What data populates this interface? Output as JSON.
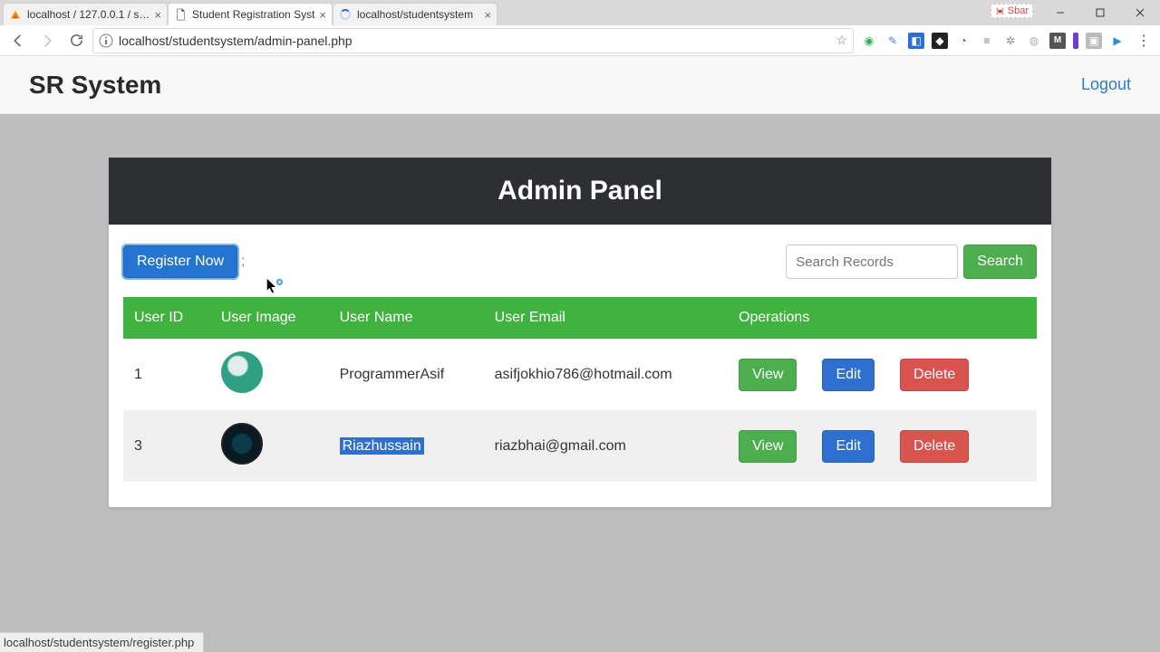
{
  "chrome": {
    "tabs": [
      {
        "title": "localhost / 127.0.0.1 / sr…"
      },
      {
        "title": "Student Registration Syst"
      },
      {
        "title": "localhost/studentsystem"
      }
    ],
    "share_label": "Sbar",
    "url": "localhost/studentsystem/admin-panel.php"
  },
  "header": {
    "brand": "SR System",
    "logout": "Logout"
  },
  "panel": {
    "title": "Admin Panel",
    "register_btn": "Register Now",
    "search_placeholder": "Search Records",
    "search_btn": "Search"
  },
  "table": {
    "headers": {
      "id": "User ID",
      "image": "User Image",
      "name": "User Name",
      "email": "User Email",
      "ops": "Operations"
    },
    "ops": {
      "view": "View",
      "edit": "Edit",
      "delete": "Delete"
    },
    "rows": [
      {
        "id": "1",
        "name": "ProgrammerAsif",
        "email": "asifjokhio786@hotmail.com"
      },
      {
        "id": "3",
        "name": "Riazhussain",
        "email": "riazbhai@gmail.com"
      }
    ]
  },
  "status": "localhost/studentsystem/register.php"
}
